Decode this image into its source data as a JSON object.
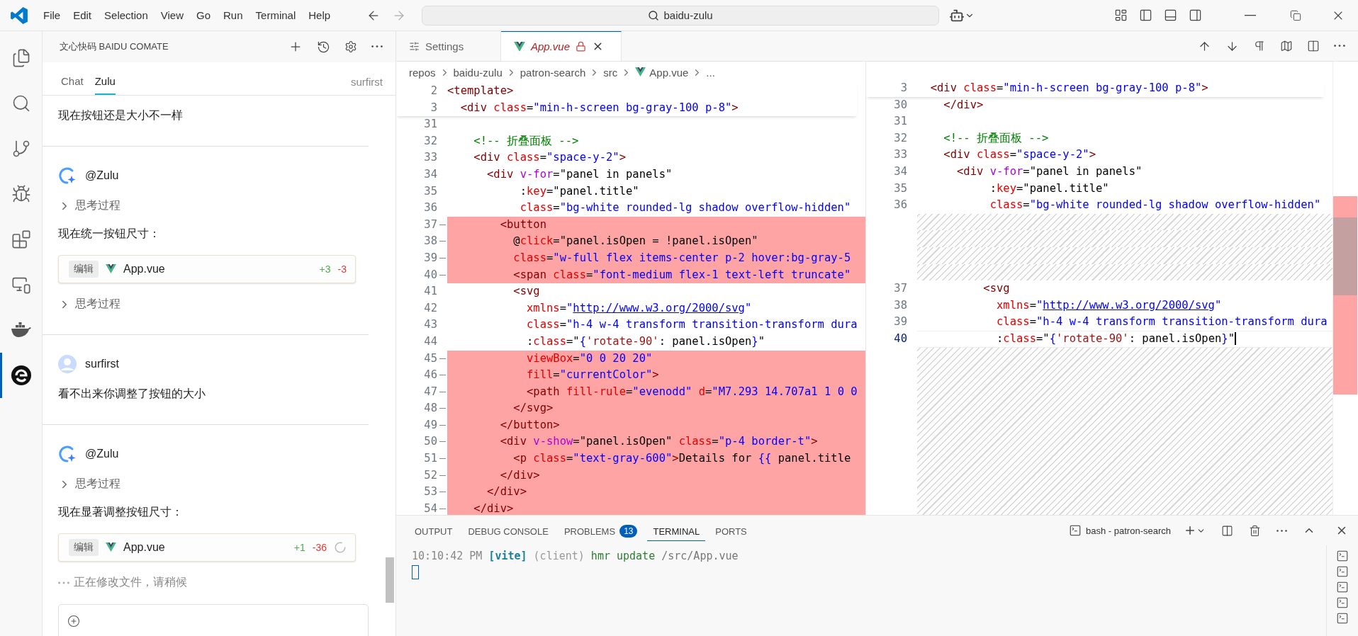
{
  "menu": [
    "File",
    "Edit",
    "Selection",
    "View",
    "Go",
    "Run",
    "Terminal",
    "Help"
  ],
  "command_center": {
    "text": "baidu-zulu"
  },
  "activity_bar": [
    {
      "kind": "explorer",
      "selected": false
    },
    {
      "kind": "search",
      "selected": false
    },
    {
      "kind": "scm",
      "selected": false
    },
    {
      "kind": "debug",
      "selected": false
    },
    {
      "kind": "extensions",
      "selected": false
    },
    {
      "kind": "remote",
      "selected": false
    },
    {
      "kind": "docker",
      "selected": false
    },
    {
      "kind": "comate",
      "selected": true
    }
  ],
  "sidebar": {
    "title": "文心快码 BAIDU COMATE",
    "tabs": [
      {
        "label": "Chat",
        "selected": false
      },
      {
        "label": "Zulu",
        "selected": true
      }
    ],
    "user": "surfirst",
    "messages": [
      {
        "kind": "user",
        "blocks": [
          {
            "kind": "text",
            "text": "现在按钮还是大小不一样"
          }
        ]
      },
      {
        "kind": "assistant",
        "author": "@Zulu",
        "blocks": [
          {
            "kind": "thinking",
            "label": "思考过程",
            "expanded": false
          },
          {
            "kind": "text",
            "text": "现在统一按钮尺寸："
          },
          {
            "kind": "file_edit",
            "action": "编辑",
            "file": "App.vue",
            "added": "+3",
            "removed": "-3",
            "pending": false
          },
          {
            "kind": "thinking",
            "label": "思考过程",
            "expanded": false
          }
        ]
      },
      {
        "kind": "user",
        "author": "surfirst",
        "blocks": [
          {
            "kind": "text",
            "text": "看不出来你调整了按钮的大小"
          }
        ]
      },
      {
        "kind": "assistant",
        "author": "@Zulu",
        "blocks": [
          {
            "kind": "thinking",
            "label": "思考过程",
            "expanded": false
          },
          {
            "kind": "text",
            "text": "现在显著调整按钮尺寸："
          },
          {
            "kind": "file_edit",
            "action": "编辑",
            "file": "App.vue",
            "added": "+1",
            "removed": "-36",
            "pending": true
          },
          {
            "kind": "status",
            "text": "正在修改文件，请稍候"
          }
        ]
      }
    ]
  },
  "editor_tabs": [
    {
      "label": "Settings",
      "kind": "settings",
      "selected": false,
      "preview": false,
      "readonly": false
    },
    {
      "label": "App.vue",
      "kind": "vue",
      "selected": true,
      "preview": true,
      "readonly": true
    }
  ],
  "breadcrumbs": [
    {
      "label": "repos",
      "kind": "folder"
    },
    {
      "label": "baidu-zulu",
      "kind": "folder"
    },
    {
      "label": "patron-search",
      "kind": "folder"
    },
    {
      "label": "src",
      "kind": "folder"
    },
    {
      "label": "App.vue",
      "kind": "vue"
    },
    {
      "label": "...",
      "kind": "more"
    }
  ],
  "diff": {
    "left": {
      "sticky": [
        {
          "number": "2",
          "tokens": [
            {
              "kind": "tag",
              "text": "<template>"
            }
          ]
        },
        {
          "number": "3",
          "tokens": [
            {
              "kind": "tag",
              "text": "  <div"
            },
            {
              "kind": "attr",
              "text": " class"
            },
            {
              "kind": "text",
              "text": "="
            },
            {
              "kind": "str",
              "text": "\"min-h-screen bg-gray-100 p-8\""
            },
            {
              "kind": "tag",
              "text": ">"
            }
          ]
        }
      ],
      "lines": [
        {
          "number": "31",
          "kind": "normal"
        },
        {
          "number": "32",
          "kind": "normal",
          "tokens": [
            {
              "kind": "comment",
              "text": "    <!-- 折叠面板 -->"
            }
          ]
        },
        {
          "number": "33",
          "kind": "normal",
          "tokens": [
            {
              "kind": "tag",
              "text": "    <div"
            },
            {
              "kind": "attr",
              "text": " class"
            },
            {
              "kind": "text",
              "text": "="
            },
            {
              "kind": "str",
              "text": "\"space-y-2\""
            },
            {
              "kind": "tag",
              "text": ">"
            }
          ]
        },
        {
          "number": "34",
          "kind": "normal",
          "tokens": [
            {
              "kind": "tag",
              "text": "      <div"
            },
            {
              "kind": "dir",
              "text": " v-for"
            },
            {
              "kind": "text",
              "text": "=\"panel in panels\""
            }
          ]
        },
        {
          "number": "35",
          "kind": "normal",
          "tokens": [
            {
              "kind": "text",
              "text": "           :"
            },
            {
              "kind": "attr",
              "text": "key"
            },
            {
              "kind": "text",
              "text": "=\"panel.title\""
            }
          ]
        },
        {
          "number": "36",
          "kind": "normal",
          "tokens": [
            {
              "kind": "attr",
              "text": "           class"
            },
            {
              "kind": "text",
              "text": "="
            },
            {
              "kind": "str",
              "text": "\"bg-white rounded-lg shadow overflow-hidden\""
            }
          ]
        },
        {
          "number": "37",
          "kind": "removed",
          "tokens": [
            {
              "kind": "tag",
              "text": "        <button"
            }
          ]
        },
        {
          "number": "38",
          "kind": "removed",
          "tokens": [
            {
              "kind": "text",
              "text": "          @"
            },
            {
              "kind": "attr",
              "text": "click"
            },
            {
              "kind": "text",
              "text": "=\"panel.isOpen = !panel.isOpen\""
            }
          ]
        },
        {
          "number": "39",
          "kind": "removed",
          "tokens": [
            {
              "kind": "attr",
              "text": "          class"
            },
            {
              "kind": "text",
              "text": "="
            },
            {
              "kind": "str",
              "text": "\"w-full flex items-center p-2 hover:bg-gray-5"
            }
          ]
        },
        {
          "number": "40",
          "kind": "removed",
          "tokens": [
            {
              "kind": "tag",
              "text": "          <span"
            },
            {
              "kind": "attr",
              "text": " class"
            },
            {
              "kind": "text",
              "text": "="
            },
            {
              "kind": "str",
              "text": "\"font-medium flex-1 text-left truncate\""
            }
          ]
        },
        {
          "number": "41",
          "kind": "normal",
          "tokens": [
            {
              "kind": "tag",
              "text": "          <svg"
            }
          ]
        },
        {
          "number": "42",
          "kind": "normal",
          "tokens": [
            {
              "kind": "attr",
              "text": "            xmlns"
            },
            {
              "kind": "text",
              "text": "="
            },
            {
              "kind": "str",
              "text": "\""
            },
            {
              "kind": "link",
              "text": "http://www.w3.org/2000/svg"
            },
            {
              "kind": "str",
              "text": "\""
            }
          ]
        },
        {
          "number": "43",
          "kind": "normal",
          "tokens": [
            {
              "kind": "attr",
              "text": "            class"
            },
            {
              "kind": "text",
              "text": "="
            },
            {
              "kind": "str",
              "text": "\"h-4 w-4 transform transition-transform dura"
            }
          ]
        },
        {
          "number": "44",
          "kind": "normal",
          "tokens": [
            {
              "kind": "text",
              "text": "            :"
            },
            {
              "kind": "attr",
              "text": "class"
            },
            {
              "kind": "text",
              "text": "=\""
            },
            {
              "kind": "str",
              "text": "{"
            },
            {
              "kind": "jsstr",
              "text": "'rotate-90'"
            },
            {
              "kind": "text",
              "text": ": panel.isOpen"
            },
            {
              "kind": "str",
              "text": "}"
            },
            {
              "kind": "text",
              "text": "\""
            }
          ]
        },
        {
          "number": "45",
          "kind": "removed",
          "tokens": [
            {
              "kind": "attr",
              "text": "            viewBox"
            },
            {
              "kind": "text",
              "text": "="
            },
            {
              "kind": "str",
              "text": "\"0 0 20 20\""
            }
          ]
        },
        {
          "number": "46",
          "kind": "removed",
          "tokens": [
            {
              "kind": "attr",
              "text": "            fill"
            },
            {
              "kind": "text",
              "text": "="
            },
            {
              "kind": "str",
              "text": "\"currentColor\""
            },
            {
              "kind": "tag",
              "text": ">"
            }
          ]
        },
        {
          "number": "47",
          "kind": "removed",
          "tokens": [
            {
              "kind": "tag",
              "text": "            <path"
            },
            {
              "kind": "attr",
              "text": " fill-rule"
            },
            {
              "kind": "text",
              "text": "="
            },
            {
              "kind": "str",
              "text": "\"evenodd\""
            },
            {
              "kind": "attr",
              "text": " d"
            },
            {
              "kind": "text",
              "text": "="
            },
            {
              "kind": "str",
              "text": "\"M7.293 14.707a1 1 0 0"
            }
          ]
        },
        {
          "number": "48",
          "kind": "removed",
          "tokens": [
            {
              "kind": "tag",
              "text": "          </svg>"
            }
          ]
        },
        {
          "number": "49",
          "kind": "removed",
          "tokens": [
            {
              "kind": "tag",
              "text": "        </button>"
            }
          ]
        },
        {
          "number": "50",
          "kind": "removed",
          "tokens": [
            {
              "kind": "tag",
              "text": "        <div"
            },
            {
              "kind": "dir",
              "text": " v-show"
            },
            {
              "kind": "text",
              "text": "=\"panel.isOpen\""
            },
            {
              "kind": "attr",
              "text": " class"
            },
            {
              "kind": "text",
              "text": "="
            },
            {
              "kind": "str",
              "text": "\"p-4 border-t\""
            },
            {
              "kind": "tag",
              "text": ">"
            }
          ]
        },
        {
          "number": "51",
          "kind": "removed",
          "tokens": [
            {
              "kind": "tag",
              "text": "          <p"
            },
            {
              "kind": "attr",
              "text": " class"
            },
            {
              "kind": "text",
              "text": "="
            },
            {
              "kind": "str",
              "text": "\"text-gray-600\""
            },
            {
              "kind": "tag",
              "text": ">"
            },
            {
              "kind": "text",
              "text": "Details for "
            },
            {
              "kind": "str",
              "text": "{{"
            },
            {
              "kind": "text",
              "text": " panel.title"
            }
          ]
        },
        {
          "number": "52",
          "kind": "removed",
          "tokens": [
            {
              "kind": "tag",
              "text": "        </div>"
            }
          ]
        },
        {
          "number": "53",
          "kind": "removed",
          "tokens": [
            {
              "kind": "tag",
              "text": "      </div>"
            }
          ]
        },
        {
          "number": "54",
          "kind": "removed",
          "tokens": [
            {
              "kind": "tag",
              "text": "    </div>"
            }
          ]
        }
      ]
    },
    "right": {
      "sticky": [
        {
          "number": "3",
          "tokens": [
            {
              "kind": "tag",
              "text": "  <div"
            },
            {
              "kind": "attr",
              "text": " class"
            },
            {
              "kind": "text",
              "text": "="
            },
            {
              "kind": "str",
              "text": "\"min-h-screen bg-gray-100 p-8\""
            },
            {
              "kind": "tag",
              "text": ">"
            }
          ]
        }
      ],
      "lines": [
        {
          "number": "30",
          "kind": "normal",
          "tokens": [
            {
              "kind": "tag",
              "text": "    </div>"
            }
          ]
        },
        {
          "number": "31",
          "kind": "normal"
        },
        {
          "number": "32",
          "kind": "normal",
          "tokens": [
            {
              "kind": "comment",
              "text": "    <!-- 折叠面板 -->"
            }
          ]
        },
        {
          "number": "33",
          "kind": "normal",
          "tokens": [
            {
              "kind": "tag",
              "text": "    <div"
            },
            {
              "kind": "attr",
              "text": " class"
            },
            {
              "kind": "text",
              "text": "="
            },
            {
              "kind": "str",
              "text": "\"space-y-2\""
            },
            {
              "kind": "tag",
              "text": ">"
            }
          ]
        },
        {
          "number": "34",
          "kind": "normal",
          "tokens": [
            {
              "kind": "tag",
              "text": "      <div"
            },
            {
              "kind": "dir",
              "text": " v-for"
            },
            {
              "kind": "text",
              "text": "=\"panel in panels\""
            }
          ]
        },
        {
          "number": "35",
          "kind": "normal",
          "tokens": [
            {
              "kind": "text",
              "text": "           :"
            },
            {
              "kind": "attr",
              "text": "key"
            },
            {
              "kind": "text",
              "text": "=\"panel.title\""
            }
          ]
        },
        {
          "number": "36",
          "kind": "normal",
          "tokens": [
            {
              "kind": "attr",
              "text": "           class"
            },
            {
              "kind": "text",
              "text": "="
            },
            {
              "kind": "str",
              "text": "\"bg-white rounded-lg shadow overflow-hidden\""
            }
          ]
        },
        {
          "kind": "filler"
        },
        {
          "kind": "filler"
        },
        {
          "kind": "filler"
        },
        {
          "kind": "filler"
        },
        {
          "number": "37",
          "kind": "normal",
          "tokens": [
            {
              "kind": "tag",
              "text": "          <svg"
            }
          ]
        },
        {
          "number": "38",
          "kind": "normal",
          "tokens": [
            {
              "kind": "attr",
              "text": "            xmlns"
            },
            {
              "kind": "text",
              "text": "="
            },
            {
              "kind": "str",
              "text": "\""
            },
            {
              "kind": "link",
              "text": "http://www.w3.org/2000/svg"
            },
            {
              "kind": "str",
              "text": "\""
            }
          ]
        },
        {
          "number": "39",
          "kind": "normal",
          "tokens": [
            {
              "kind": "attr",
              "text": "            class"
            },
            {
              "kind": "text",
              "text": "="
            },
            {
              "kind": "str",
              "text": "\"h-4 w-4 transform transition-transform dura"
            }
          ]
        },
        {
          "number": "40",
          "kind": "current",
          "tokens": [
            {
              "kind": "text",
              "text": "            :"
            },
            {
              "kind": "attr",
              "text": "class"
            },
            {
              "kind": "text",
              "text": "=\""
            },
            {
              "kind": "str",
              "text": "{"
            },
            {
              "kind": "jsstr",
              "text": "'rotate-90'"
            },
            {
              "kind": "text",
              "text": ": panel.isOpen"
            },
            {
              "kind": "str",
              "text": "}"
            },
            {
              "kind": "text",
              "text": "\""
            }
          ]
        }
      ],
      "fill_rest": true
    }
  },
  "panel": {
    "tabs": [
      {
        "label": "OUTPUT",
        "selected": false
      },
      {
        "label": "DEBUG CONSOLE",
        "selected": false
      },
      {
        "label": "PROBLEMS",
        "selected": false,
        "badge": "13"
      },
      {
        "label": "TERMINAL",
        "selected": true
      },
      {
        "label": "PORTS",
        "selected": false
      }
    ],
    "terminal_name": "bash - patron-search",
    "terminal_lines": [
      [
        {
          "kind": "time",
          "text": "10:10:42 PM"
        },
        {
          "kind": "tag",
          "text": " [vite]"
        },
        {
          "kind": "muted",
          "text": " (client)"
        },
        {
          "kind": "cmd",
          "text": " hmr update"
        },
        {
          "kind": "path",
          "text": " /src/App.vue"
        }
      ]
    ]
  }
}
